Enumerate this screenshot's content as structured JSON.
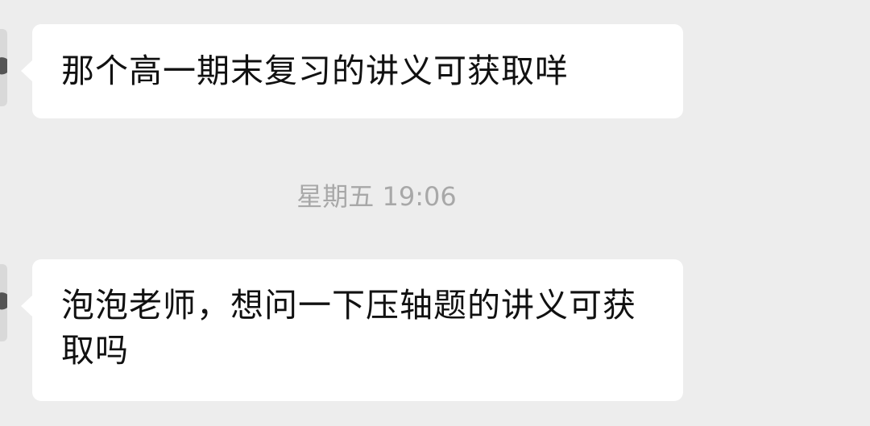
{
  "messages": [
    {
      "sender_side": "left",
      "text": "那个高一期末复习的讲义可获取咩"
    },
    {
      "sender_side": "left",
      "text": "泡泡老师，想问一下压轴题的讲义可获取吗"
    }
  ],
  "timestamp": "星期五 19:06",
  "colors": {
    "background": "#ededed",
    "bubble": "#ffffff",
    "text": "#111111",
    "timestamp": "#a8a8a8"
  }
}
